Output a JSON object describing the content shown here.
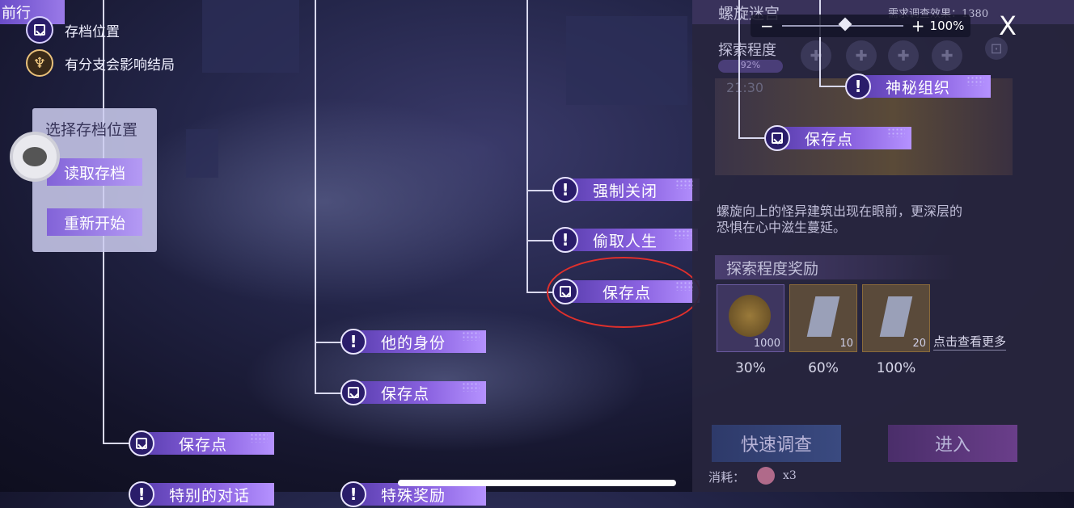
{
  "top_left_tag": "前行",
  "legend": {
    "save_location": "存档位置",
    "branch_affects_ending": "有分支会影响结局"
  },
  "choose_panel": {
    "title": "选择存档位置",
    "load_label": "读取存档",
    "restart_label": "重新开始"
  },
  "nodes": {
    "force_close": "强制关闭",
    "steal_life": "偷取人生",
    "save_point_selected": "保存点",
    "his_identity": "他的身份",
    "save_point_mid": "保存点",
    "save_point_left": "保存点",
    "special_dialogue": "特别的对话",
    "special_reward": "特殊奖励",
    "mysterious_org": "神秘组织",
    "save_point_right": "保存点"
  },
  "zoom": {
    "minus": "−",
    "plus": "+",
    "level": "100%"
  },
  "close_label": "X",
  "side_panel": {
    "title": "螺旋迷宫",
    "req_label": "需求调查效果：1380",
    "explore_label": "探索程度",
    "explore_value": "92%",
    "time": "21:30",
    "description_line1": "螺旋向上的怪异建筑出现在眼前，更深层的",
    "description_line2": "恐惧在心中滋生蔓延。",
    "reward_header": "探索程度奖励",
    "rewards": [
      {
        "qty": "1000",
        "pct": "30%"
      },
      {
        "qty": "10",
        "pct": "60%"
      },
      {
        "qty": "20",
        "pct": "100%"
      }
    ],
    "more_label": "点击查看更多",
    "quick_btn": "快速调查",
    "enter_btn": "进入",
    "cost_label": "消耗：",
    "cost_qty": "x3"
  },
  "colors": {
    "node_start": "#5b3fb0",
    "node_end": "#b592ff",
    "highlight_oval": "#e0302c"
  },
  "icons": [
    "save-icon",
    "exclaim-icon",
    "branch-icon",
    "chat-bubble-icon",
    "close-icon"
  ]
}
